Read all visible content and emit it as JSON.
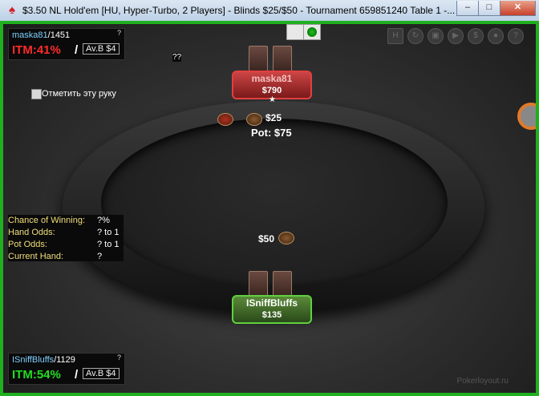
{
  "window": {
    "title": "$3.50 NL Hold'em [HU, Hyper-Turbo, 2 Players]  - Blinds $25/$50 - Tournament 659851240 Table 1 -...",
    "minimize": "–",
    "maximize": "□",
    "close": "✕"
  },
  "hud_top": {
    "user": "maska81",
    "hands": "/1451",
    "q": "?",
    "itm": "ITM:41%",
    "slash": "/",
    "avb": "Av.B $4"
  },
  "hud_bottom": {
    "user": "ISniffBluffs",
    "hands": "/1129",
    "q": "?",
    "itm": "ITM:54%",
    "slash": "/",
    "avb": "Av.B $4"
  },
  "stray_q": "??",
  "checkbox_label": "Отметить эту руку",
  "stats": {
    "rows": [
      {
        "label": "Chance of Winning:",
        "value": "?%"
      },
      {
        "label": "Hand Odds:",
        "value": "? to 1"
      },
      {
        "label": "Pot Odds:",
        "value": "? to 1"
      },
      {
        "label": "Current Hand:",
        "value": "?"
      }
    ]
  },
  "seat_top": {
    "name": "maska81",
    "stack": "$790",
    "star": "★"
  },
  "seat_bottom": {
    "name": "ISniffBluffs",
    "stack": "$135"
  },
  "bets": {
    "top": "$25",
    "bottom": "$50",
    "pot": "Pot: $75"
  },
  "toolbar_icons": [
    "H",
    "↻",
    "▣",
    "▶",
    "$",
    "●",
    "?"
  ],
  "watermark": "Pokerloyout.ru",
  "colors": {
    "frame": "#1fb01f",
    "top_seat_border": "#e04040",
    "bottom_seat_border": "#60d040",
    "itm_red": "#ff2a2a",
    "itm_green": "#22dd22"
  }
}
